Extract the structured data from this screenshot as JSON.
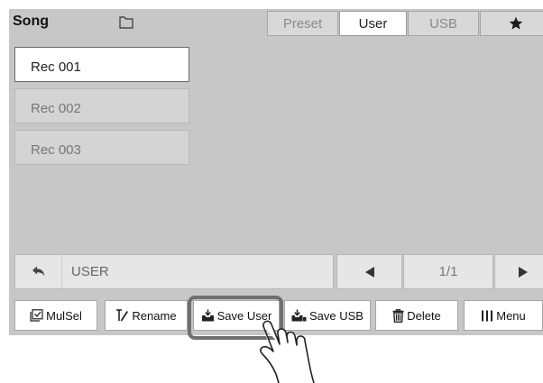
{
  "header": {
    "title": "Song",
    "folder_icon": "folder-icon"
  },
  "tabs": [
    {
      "label": "Preset",
      "active": false
    },
    {
      "label": "User",
      "active": true
    },
    {
      "label": "USB",
      "active": false
    },
    {
      "label": "★",
      "icon": "star-icon",
      "active": false
    }
  ],
  "list": {
    "items": [
      {
        "label": "Rec 001",
        "selected": true
      },
      {
        "label": "Rec 002",
        "selected": false
      },
      {
        "label": "Rec 003",
        "selected": false
      }
    ]
  },
  "path_bar": {
    "back_icon": "back-arrow-icon",
    "label": "USER"
  },
  "pager": {
    "prev_icon": "triangle-left-icon",
    "info": "1/1",
    "next_icon": "triangle-right-icon"
  },
  "toolbar": {
    "mulsel": "MulSel",
    "rename": "Rename",
    "save_user": "Save User",
    "save_usb": "Save USB",
    "delete": "Delete",
    "menu": "Menu"
  },
  "overlay": {
    "hand_icon": "pointing-hand-icon"
  },
  "colors": {
    "background": "#c7c7c7",
    "selected_item": "#ffffff",
    "item": "#d4d4d4",
    "highlight_ring": "#6f6f6f"
  }
}
